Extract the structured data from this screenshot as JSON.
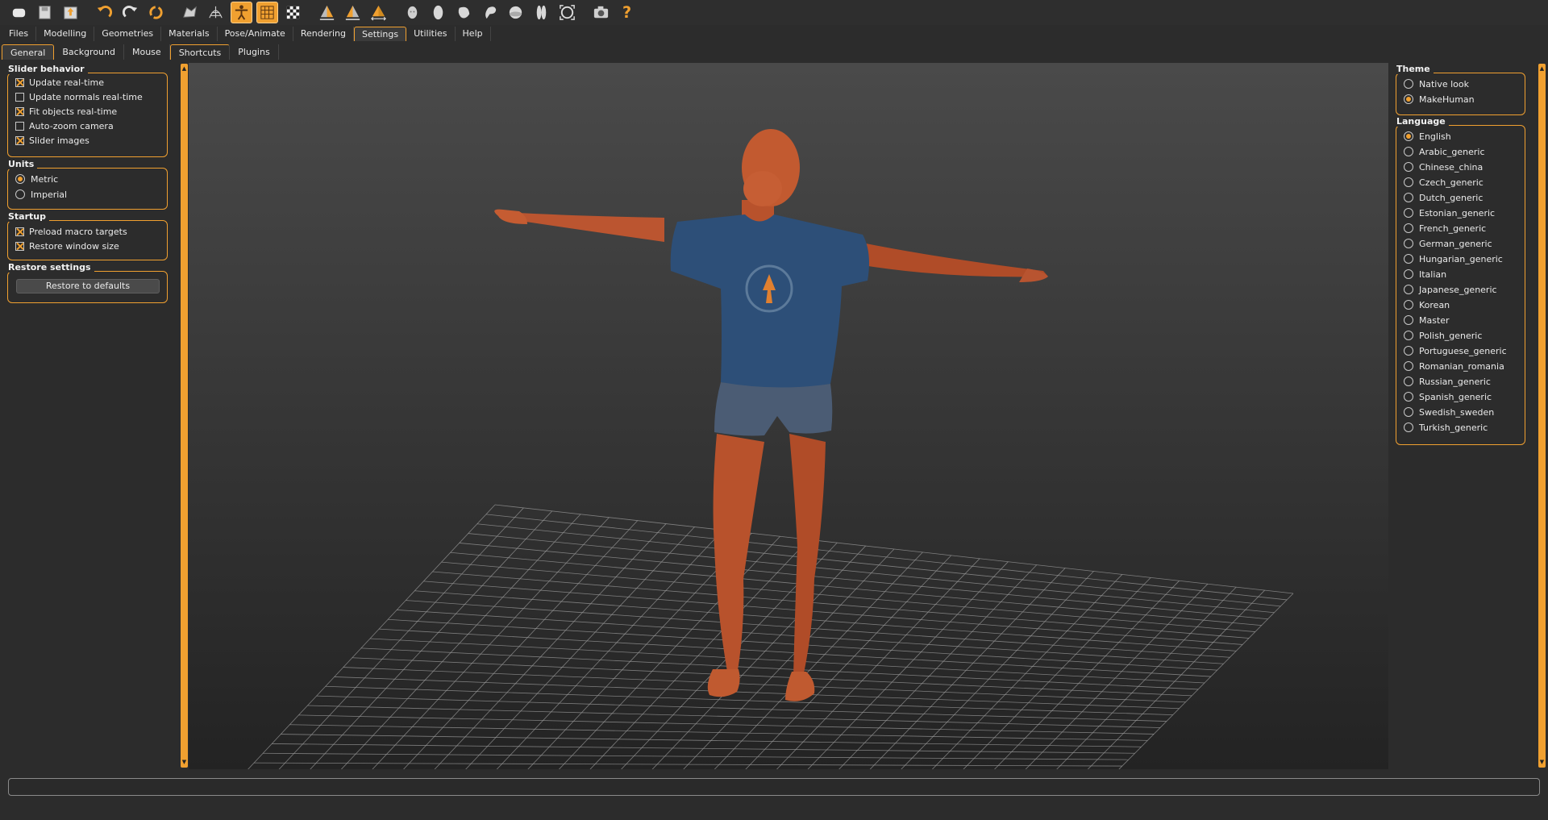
{
  "toolbar": {
    "icons": [
      "new-icon",
      "save-icon",
      "export-icon",
      "undo-icon",
      "redo-icon",
      "reset-icon",
      "smooth-icon",
      "wireframe-icon",
      "pose-icon",
      "grid-icon",
      "checker-icon",
      "front-view-icon",
      "side-view-icon",
      "top-view-icon",
      "head-icon",
      "body-icon",
      "face-icon",
      "ear-icon",
      "sphere-icon",
      "legs-icon",
      "focus-icon",
      "camera-icon",
      "help-icon"
    ]
  },
  "menu": {
    "tabs": [
      "Files",
      "Modelling",
      "Geometries",
      "Materials",
      "Pose/Animate",
      "Rendering",
      "Settings",
      "Utilities",
      "Help"
    ],
    "active": "Settings"
  },
  "subtabs": {
    "tabs": [
      "General",
      "Background",
      "Mouse",
      "Shortcuts",
      "Plugins"
    ],
    "active": "General"
  },
  "slider_behavior": {
    "title": "Slider behavior",
    "items": [
      {
        "label": "Update real-time",
        "checked": true
      },
      {
        "label": "Update normals real-time",
        "checked": false
      },
      {
        "label": "Fit objects real-time",
        "checked": true
      },
      {
        "label": "Auto-zoom camera",
        "checked": false
      },
      {
        "label": "Slider images",
        "checked": true
      }
    ]
  },
  "units": {
    "title": "Units",
    "items": [
      {
        "label": "Metric",
        "checked": true
      },
      {
        "label": "Imperial",
        "checked": false
      }
    ]
  },
  "startup": {
    "title": "Startup",
    "items": [
      {
        "label": "Preload macro targets",
        "checked": true
      },
      {
        "label": "Restore window size",
        "checked": true
      }
    ]
  },
  "restore": {
    "title": "Restore settings",
    "button": "Restore to defaults"
  },
  "theme": {
    "title": "Theme",
    "items": [
      {
        "label": "Native look",
        "checked": false
      },
      {
        "label": "MakeHuman",
        "checked": true
      }
    ]
  },
  "language": {
    "title": "Language",
    "items": [
      {
        "label": "English",
        "checked": true
      },
      {
        "label": "Arabic_generic",
        "checked": false
      },
      {
        "label": "Chinese_china",
        "checked": false
      },
      {
        "label": "Czech_generic",
        "checked": false
      },
      {
        "label": "Dutch_generic",
        "checked": false
      },
      {
        "label": "Estonian_generic",
        "checked": false
      },
      {
        "label": "French_generic",
        "checked": false
      },
      {
        "label": "German_generic",
        "checked": false
      },
      {
        "label": "Hungarian_generic",
        "checked": false
      },
      {
        "label": "Italian",
        "checked": false
      },
      {
        "label": "Japanese_generic",
        "checked": false
      },
      {
        "label": "Korean",
        "checked": false
      },
      {
        "label": "Master",
        "checked": false
      },
      {
        "label": "Polish_generic",
        "checked": false
      },
      {
        "label": "Portuguese_generic",
        "checked": false
      },
      {
        "label": "Romanian_romania",
        "checked": false
      },
      {
        "label": "Russian_generic",
        "checked": false
      },
      {
        "label": "Spanish_generic",
        "checked": false
      },
      {
        "label": "Swedish_sweden",
        "checked": false
      },
      {
        "label": "Turkish_generic",
        "checked": false
      }
    ]
  },
  "colors": {
    "accent": "#f0a030",
    "background": "#2c2c2c",
    "skin": "#c0572e",
    "shirt": "#2d4f78",
    "shorts": "#4b5c74"
  }
}
